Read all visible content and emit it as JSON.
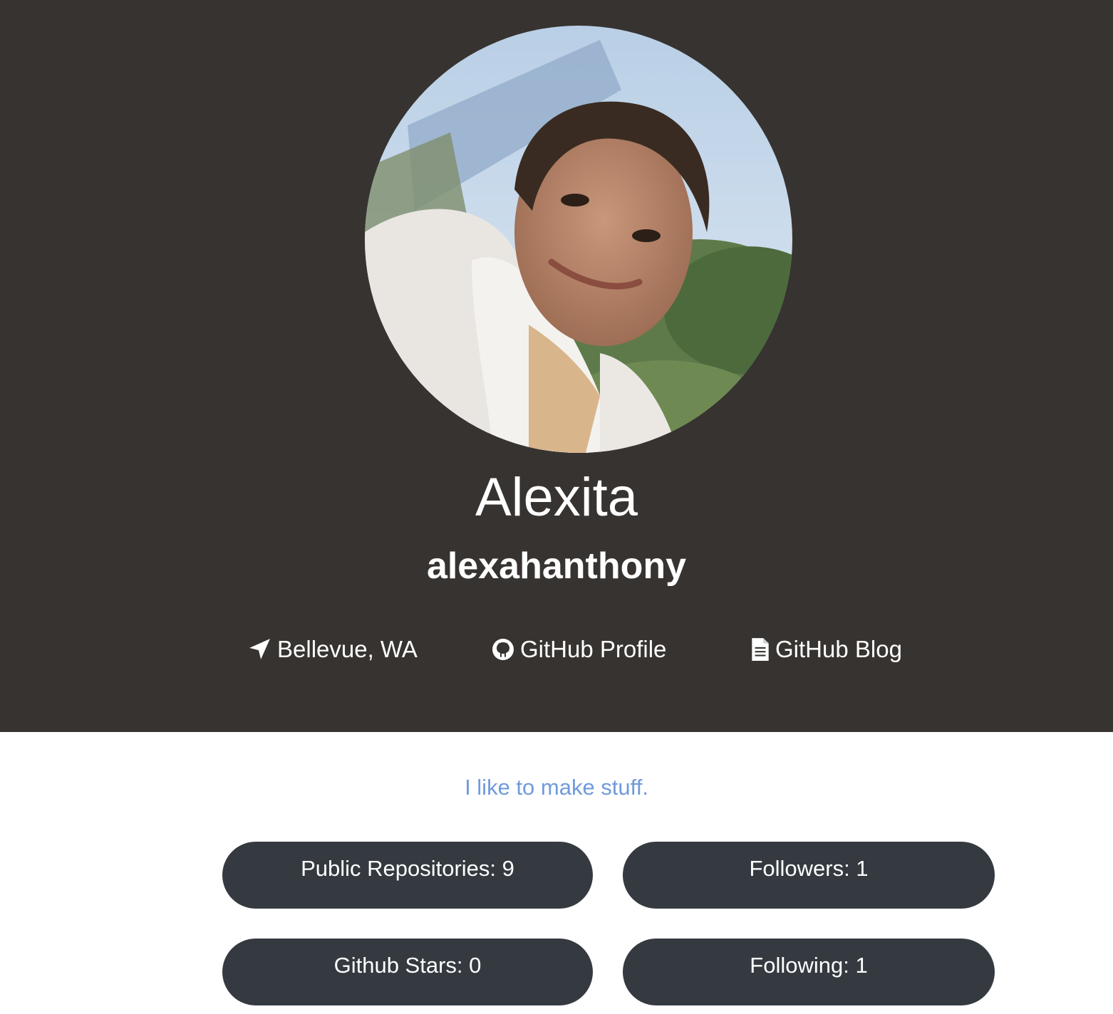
{
  "profile": {
    "name": "Alexita",
    "username": "alexahanthony",
    "bio": "I like to make stuff.",
    "avatar_alt": "profile photo"
  },
  "links": {
    "location": {
      "label": "Bellevue, WA",
      "icon": "location-arrow-icon"
    },
    "github_profile": {
      "label": "GitHub Profile",
      "icon": "github-icon"
    },
    "github_blog": {
      "label": "GitHub Blog",
      "icon": "document-icon"
    }
  },
  "stats": {
    "public_repositories": "Public Repositories: 9",
    "followers": "Followers: 1",
    "github_stars": "Github Stars: 0",
    "following": "Following: 1"
  },
  "colors": {
    "header_bg": "#373330",
    "bio_text": "#6f9bdd",
    "stat_bg": "#343a40",
    "text_light": "#ffffff"
  }
}
